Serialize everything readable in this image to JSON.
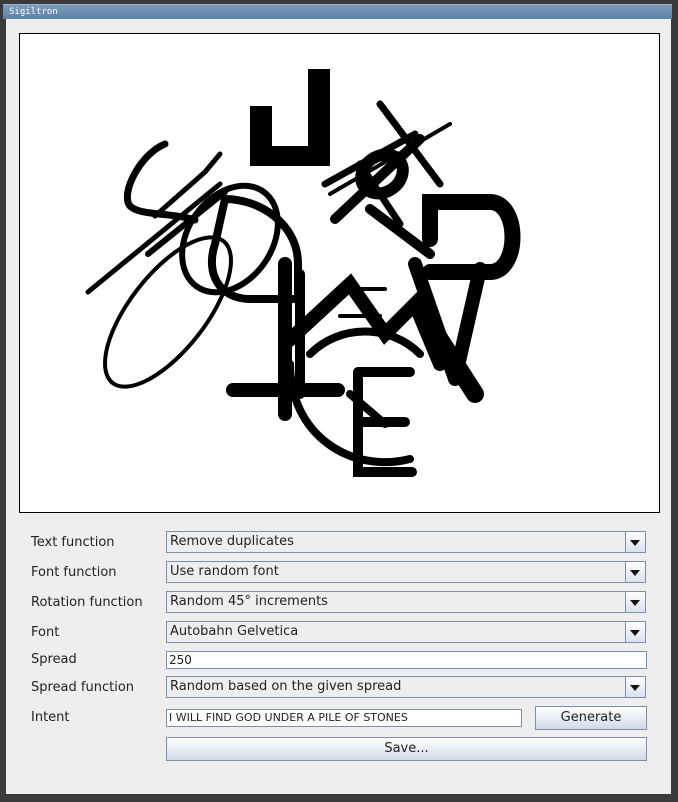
{
  "window": {
    "title": "Sigiltron"
  },
  "controls": {
    "text_function": {
      "label": "Text function",
      "value": "Remove duplicates"
    },
    "font_function": {
      "label": "Font function",
      "value": "Use random font"
    },
    "rotation_function": {
      "label": "Rotation function",
      "value": "Random 45° increments"
    },
    "font": {
      "label": "Font",
      "value": "Autobahn Gelvetica"
    },
    "spread": {
      "label": "Spread",
      "value": "250"
    },
    "spread_function": {
      "label": "Spread function",
      "value": "Random based on the given spread"
    },
    "intent": {
      "label": "Intent",
      "value": "I WILL FIND GOD UNDER A PILE OF STONES"
    },
    "generate_label": "Generate",
    "save_label": "Save..."
  },
  "icons": {
    "dropdown": "chevron-down-icon"
  }
}
